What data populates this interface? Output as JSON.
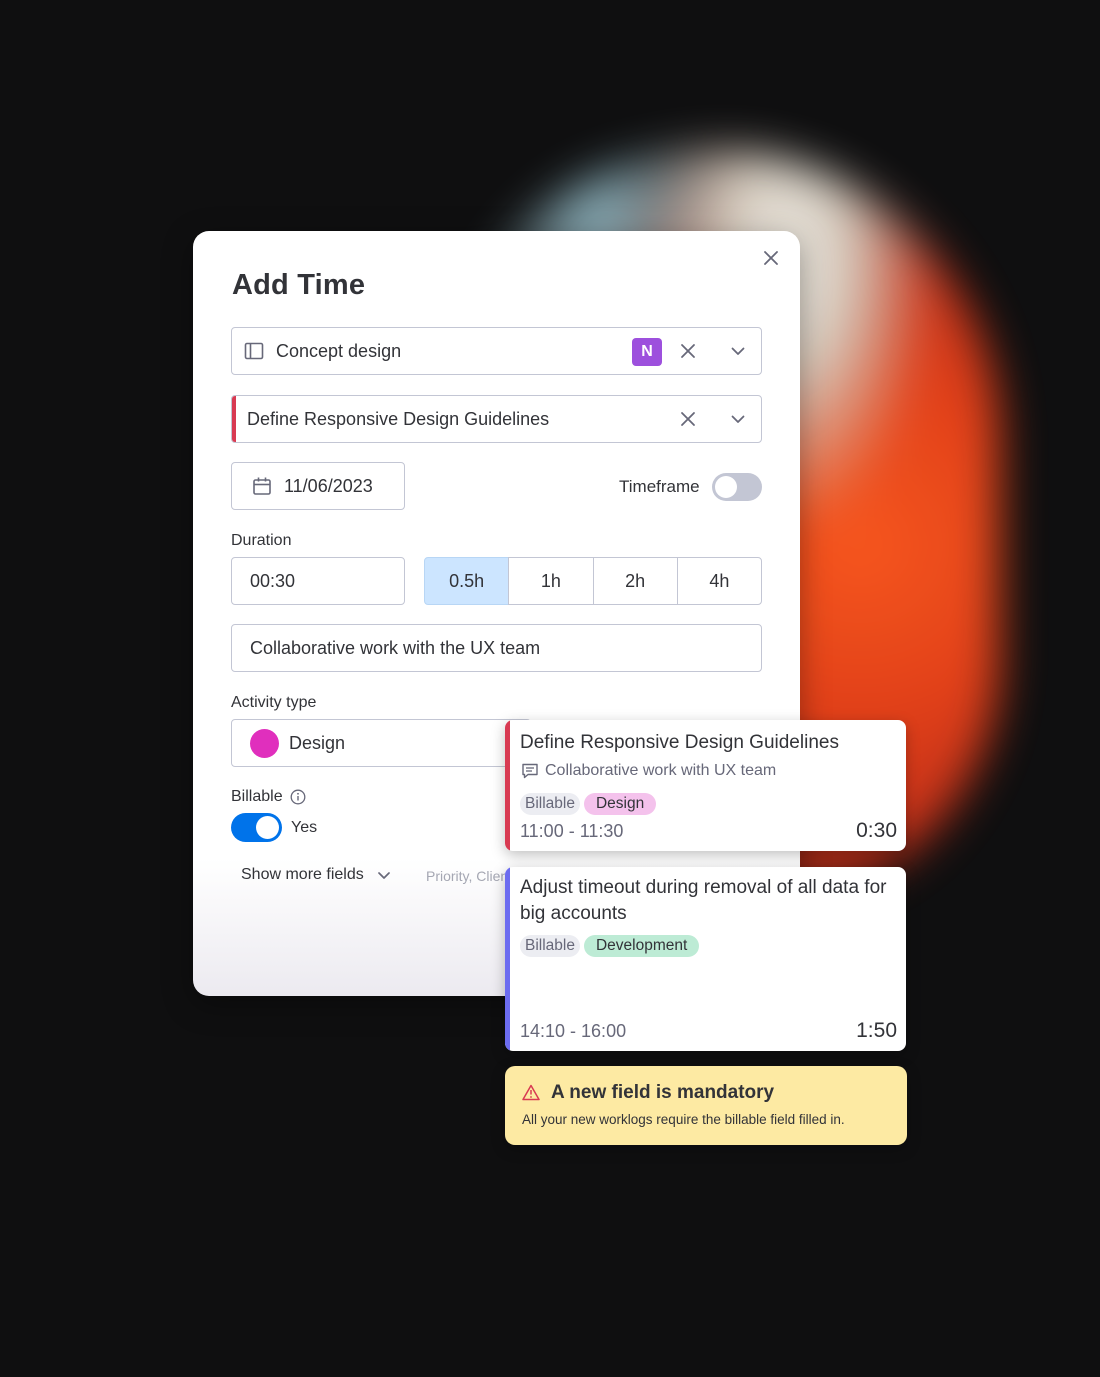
{
  "dialog": {
    "title": "Add Time",
    "project": {
      "value": "Concept design",
      "badge": "N",
      "badge_color": "#9d50dd"
    },
    "task": {
      "value": "Define Responsive Design Guidelines",
      "accent_color": "#d83a52"
    },
    "date": {
      "value": "11/06/2023"
    },
    "timeframe": {
      "label": "Timeframe",
      "enabled": false
    },
    "duration": {
      "label": "Duration",
      "value": "00:30",
      "presets": [
        "0.5h",
        "1h",
        "2h",
        "4h"
      ],
      "selected": "0.5h"
    },
    "description": {
      "value": "Collaborative work with the UX team"
    },
    "activity": {
      "label": "Activity type",
      "value": "Design",
      "color": "#e02fbd"
    },
    "billable": {
      "label": "Billable",
      "value_label": "Yes",
      "enabled": true
    },
    "show_more": {
      "label": "Show more fields",
      "hint": "Priority, Client"
    }
  },
  "worklogs": [
    {
      "title": "Define Responsive Design Guidelines",
      "description": "Collaborative work with UX team",
      "tags": [
        "Billable",
        "Design"
      ],
      "time_range": "11:00 - 11:30",
      "duration": "0:30",
      "accent_color": "#d83a52"
    },
    {
      "title": "Adjust timeout during removal of all data for big accounts",
      "tags": [
        "Billable",
        "Development"
      ],
      "time_range": "14:10 - 16:00",
      "duration": "1:50",
      "accent_color": "#6c6cf0"
    }
  ],
  "alert": {
    "title": "A new field is mandatory",
    "text": "All your new worklogs require the billable field filled in.",
    "background": "#fdeaa3"
  }
}
